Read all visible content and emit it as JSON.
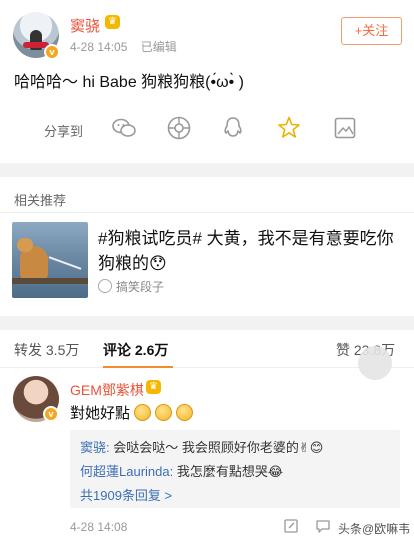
{
  "post": {
    "username": "窦骁",
    "time": "4-28 14:05",
    "edited": "已编辑",
    "follow_label": "+关注",
    "text": "哈哈哈～ hi Babe 狗粮狗粮(•́ω•̀ )",
    "share_label": "分享到",
    "share_icons": [
      "wechat-icon",
      "moments-icon",
      "qq-icon",
      "qzone-icon",
      "image-icon"
    ]
  },
  "related": {
    "title": "相关推荐",
    "headline": "#狗粮试吃员# 大黄，我不是有意要吃你狗粮的😯",
    "source": "搞笑段子"
  },
  "tabs": {
    "repost": "转发 3.5万",
    "comment": "评论 2.6万",
    "like": "赞 23.8万"
  },
  "comment": {
    "name": "GEM鄧紫棋",
    "text": "對她好點",
    "replies": [
      {
        "name": "窦骁:",
        "text": " 会哒会哒～ 我会照顾好你老婆的✌😊"
      },
      {
        "name": "何超蓮Laurinda:",
        "text": " 我怎麼有點想哭😂"
      }
    ],
    "more_replies": "共1909条回复 >",
    "time": "4-28 14:08"
  },
  "watermark": "头条@欧嘛韦",
  "colors": {
    "name": "#e8533a",
    "accent": "#f28c28",
    "link": "#3b6fb5"
  }
}
